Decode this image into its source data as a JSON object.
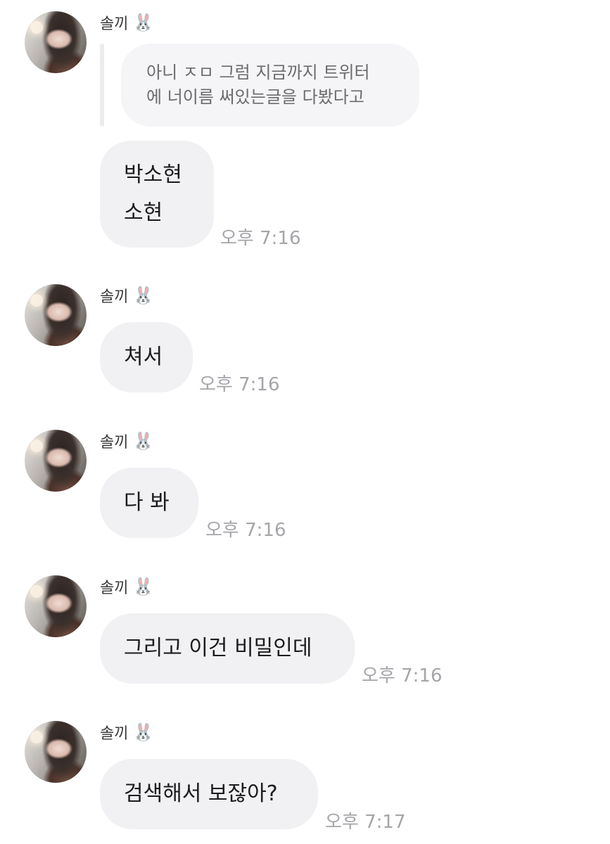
{
  "messages": [
    {
      "sender": "솔끼",
      "sender_emoji": "🐰",
      "reply_quote": {
        "line1": "아니 ㅈㅁ 그럼 지금까지 트위터",
        "line2": "에 너이름 써있는글을 다봤다고"
      },
      "text_lines": [
        "박소현",
        "소현"
      ],
      "time": "오후 7:16"
    },
    {
      "sender": "솔끼",
      "sender_emoji": "🐰",
      "text": "쳐서",
      "time": "오후 7:16"
    },
    {
      "sender": "솔끼",
      "sender_emoji": "🐰",
      "text": "다 봐",
      "time": "오후 7:16"
    },
    {
      "sender": "솔끼",
      "sender_emoji": "🐰",
      "text": "그리고 이건 비밀인데",
      "time": "오후 7:16"
    },
    {
      "sender": "솔끼",
      "sender_emoji": "🐰",
      "text": "검색해서 보잖아?",
      "time": "오후 7:17"
    }
  ]
}
